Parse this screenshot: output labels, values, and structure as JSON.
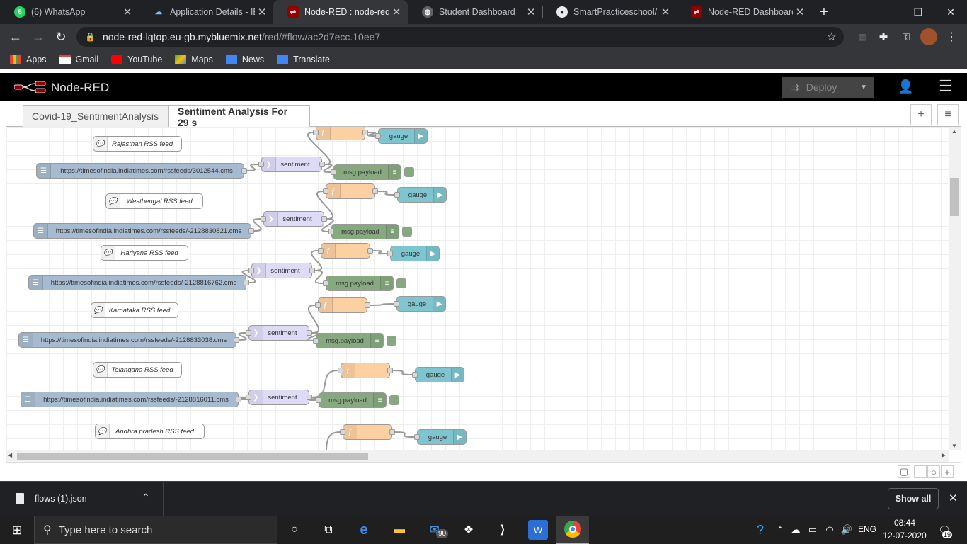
{
  "browser": {
    "tabs": [
      {
        "title": "(6) WhatsApp",
        "icon": "whatsapp-icon",
        "badge": "6"
      },
      {
        "title": "Application Details - IBM",
        "icon": "ibm-cloud-icon"
      },
      {
        "title": "Node-RED : node-red-l",
        "icon": "node-red-icon"
      },
      {
        "title": "Student Dashboard",
        "icon": "globe-icon"
      },
      {
        "title": "SmartPracticeschool/SB",
        "icon": "github-icon"
      },
      {
        "title": "Node-RED Dashboard",
        "icon": "node-red-icon"
      }
    ],
    "url_host": "node-red-lqtop.eu-gb.mybluemix.net",
    "url_path": "/red/#flow/ac2d7ecc.10ee7",
    "bookmarks": [
      "Apps",
      "Gmail",
      "YouTube",
      "Maps",
      "News",
      "Translate"
    ]
  },
  "nodered": {
    "app_title": "Node-RED",
    "deploy_label": "Deploy",
    "tabs": [
      "Covid-19_SentimentAnalysis",
      "Sentiment Analysis For 29 s"
    ],
    "labels": {
      "sentiment": "sentiment",
      "gauge": "gauge",
      "debug": "msg.payload",
      "function_icon": "ƒ"
    },
    "flows": [
      {
        "comment": "Rajasthan RSS feed",
        "feed": "https://timesofindia.indiatimes.com/rssfeeds/3012544.cms"
      },
      {
        "comment": "Westbengal RSS feed",
        "feed": "https://timesofindia.indiatimes.com/rssfeeds/-2128830821.cms"
      },
      {
        "comment": "Hariyana RSS feed",
        "feed": "https://timesofindia.indiatimes.com/rssfeeds/-2128816762.cms"
      },
      {
        "comment": "Karnataka RSS feed",
        "feed": "https://timesofindia.indiatimes.com/rssfeeds/-2128833038.cms"
      },
      {
        "comment": "Telangana RSS feed",
        "feed": "https://timesofindia.indiatimes.com/rssfeeds/-2128816011.cms"
      },
      {
        "comment": "Andhra pradesh RSS feed",
        "feed": ""
      }
    ]
  },
  "download": {
    "file": "flows (1).json",
    "show_all": "Show all"
  },
  "taskbar": {
    "search_placeholder": "Type here to search",
    "mail_badge": "90",
    "lang": "ENG",
    "time": "08:44",
    "date": "12-07-2020",
    "notif": "19"
  },
  "colors": {
    "inject": "#a6bbcf",
    "function": "#fdd0a2",
    "gauge": "#7ec5cf",
    "debug": "#87a980",
    "sentiment": "#dedbf7"
  }
}
